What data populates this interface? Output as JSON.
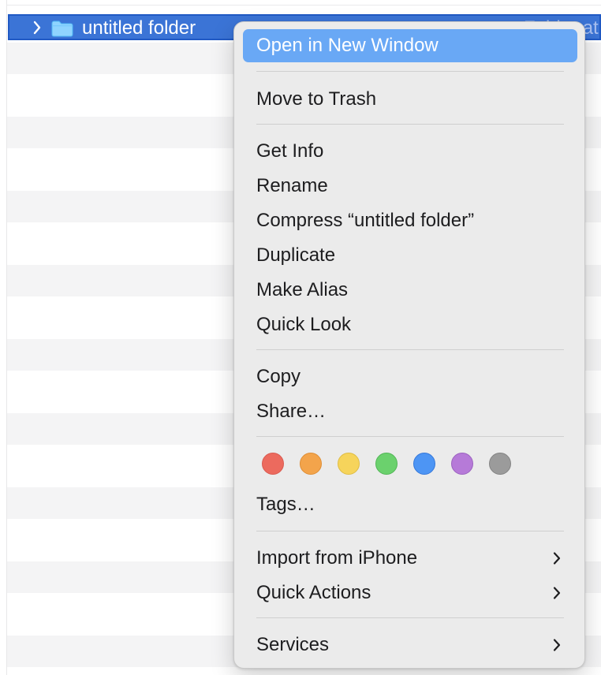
{
  "finder": {
    "selected_row": {
      "name": "untitled folder",
      "kind_partial": "Folder at"
    }
  },
  "context_menu": {
    "items": [
      {
        "label": "Open in New Window",
        "highlighted": true
      },
      {
        "label": "Move to Trash"
      },
      {
        "label": "Get Info"
      },
      {
        "label": "Rename"
      },
      {
        "label": "Compress “untitled folder”"
      },
      {
        "label": "Duplicate"
      },
      {
        "label": "Make Alias"
      },
      {
        "label": "Quick Look"
      },
      {
        "label": "Copy"
      },
      {
        "label": "Share…"
      },
      {
        "label": "Tags…"
      },
      {
        "label": "Import from iPhone",
        "submenu": true
      },
      {
        "label": "Quick Actions",
        "submenu": true
      },
      {
        "label": "Services",
        "submenu": true
      }
    ],
    "tag_colors": [
      {
        "name": "red-tag",
        "color": "#ec6a5e",
        "border": "#d95a50"
      },
      {
        "name": "orange-tag",
        "color": "#f3a44b",
        "border": "#df8e35"
      },
      {
        "name": "yellow-tag",
        "color": "#f6d45b",
        "border": "#dfbd43"
      },
      {
        "name": "green-tag",
        "color": "#6bd16d",
        "border": "#52b656"
      },
      {
        "name": "blue-tag",
        "color": "#4d95f4",
        "border": "#3578da"
      },
      {
        "name": "purple-tag",
        "color": "#b67ad8",
        "border": "#9c62c0"
      },
      {
        "name": "gray-tag",
        "color": "#9b9b9b",
        "border": "#848484"
      }
    ]
  },
  "icons": {
    "disclosure": "chevron-right-icon",
    "folder": "folder-icon",
    "submenu": "chevron-right-icon"
  }
}
